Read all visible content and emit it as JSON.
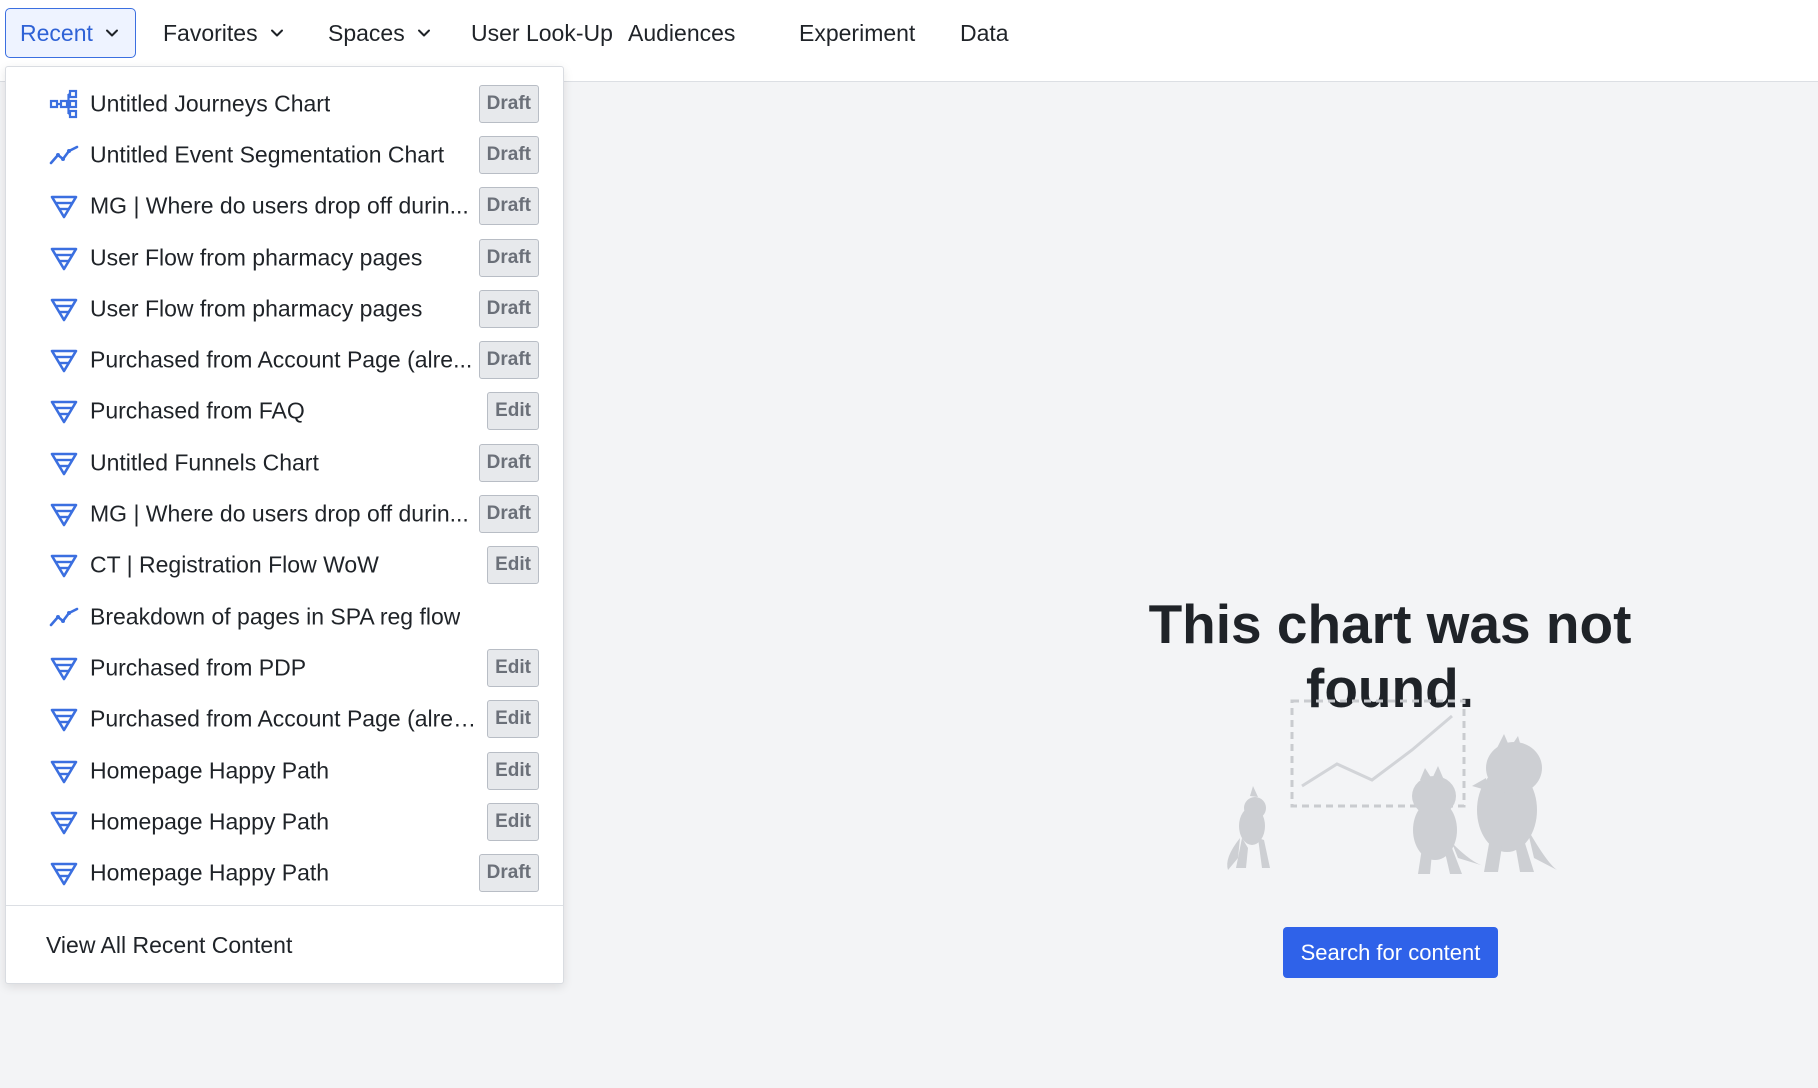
{
  "nav": {
    "items": [
      {
        "label": "Recent",
        "has_chevron": true,
        "active": true
      },
      {
        "label": "Favorites",
        "has_chevron": true,
        "active": false
      },
      {
        "label": "Spaces",
        "has_chevron": true,
        "active": false
      },
      {
        "label": "User Look-Up",
        "has_chevron": false,
        "active": false
      },
      {
        "label": "Audiences",
        "has_chevron": false,
        "active": false
      },
      {
        "label": "Experiment",
        "has_chevron": false,
        "active": false
      },
      {
        "label": "Data",
        "has_chevron": false,
        "active": false
      }
    ]
  },
  "recent_menu": {
    "items": [
      {
        "icon": "journeys-icon",
        "label": "Untitled Journeys Chart",
        "badge": "Draft"
      },
      {
        "icon": "segmentation-icon",
        "label": "Untitled Event Segmentation Chart",
        "badge": "Draft"
      },
      {
        "icon": "funnel-icon",
        "label": "MG | Where do users drop off durin...",
        "badge": "Draft"
      },
      {
        "icon": "funnel-icon",
        "label": "User Flow from pharmacy pages",
        "badge": "Draft"
      },
      {
        "icon": "funnel-icon",
        "label": "User Flow from pharmacy pages",
        "badge": "Draft"
      },
      {
        "icon": "funnel-icon",
        "label": "Purchased from Account Page (alre...",
        "badge": "Draft"
      },
      {
        "icon": "funnel-icon",
        "label": "Purchased from FAQ",
        "badge": "Edit"
      },
      {
        "icon": "funnel-icon",
        "label": "Untitled Funnels Chart",
        "badge": "Draft"
      },
      {
        "icon": "funnel-icon",
        "label": "MG | Where do users drop off durin...",
        "badge": "Draft"
      },
      {
        "icon": "funnel-icon",
        "label": "CT | Registration Flow WoW",
        "badge": "Edit"
      },
      {
        "icon": "segmentation-icon",
        "label": "Breakdown of pages in SPA reg flow",
        "badge": ""
      },
      {
        "icon": "funnel-icon",
        "label": "Purchased from PDP",
        "badge": "Edit"
      },
      {
        "icon": "funnel-icon",
        "label": "Purchased from Account Page (alrea...",
        "badge": "Edit"
      },
      {
        "icon": "funnel-icon",
        "label": "Homepage Happy Path",
        "badge": "Edit"
      },
      {
        "icon": "funnel-icon",
        "label": "Homepage Happy Path",
        "badge": "Edit"
      },
      {
        "icon": "funnel-icon",
        "label": "Homepage Happy Path",
        "badge": "Draft"
      }
    ],
    "footer_label": "View All Recent Content"
  },
  "main": {
    "title": "This chart was not found.",
    "illustration": "dinosaurs-looking-at-chart-illustration",
    "search_button": "Search for content"
  },
  "colors": {
    "accent": "#2f62e9",
    "icon_blue": "#3b6fe0",
    "page_bg": "#f3f4f6",
    "badge_bg": "#e7e9ec"
  }
}
